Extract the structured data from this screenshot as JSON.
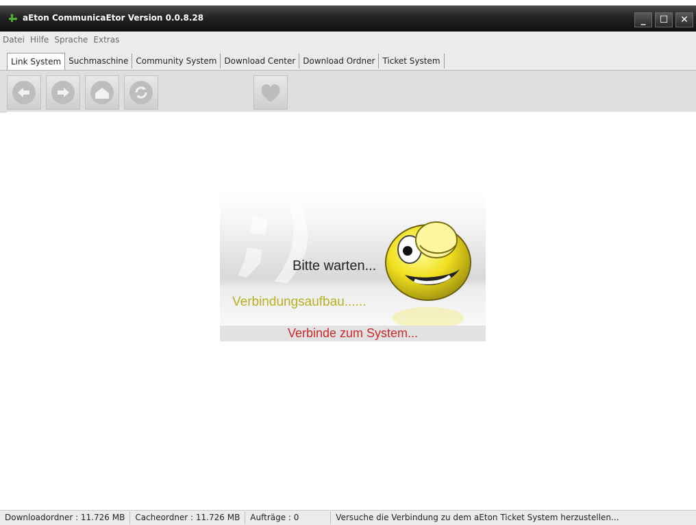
{
  "window": {
    "title": "aEton CommunicaEtor Version 0.0.8.28"
  },
  "menu": [
    "Datei",
    "Hilfe",
    "Sprache",
    "Extras"
  ],
  "tabs": [
    "Link System",
    "Suchmaschine",
    "Community System",
    "Download Center",
    "Download Ordner",
    "Ticket System"
  ],
  "active_tab": "Link System",
  "toolbar": {
    "icons": [
      "back-icon",
      "forward-icon",
      "home-icon",
      "refresh-icon",
      "favorite-heart-icon"
    ]
  },
  "splash": {
    "wait_text": "Bitte warten...",
    "connecting_text": "Verbindungsaufbau......",
    "connect_system_text": "Verbinde zum System..."
  },
  "status": {
    "download_folder": "Downloadordner :  11.726 MB",
    "cache_folder": "Cacheordner :  11.726 MB",
    "jobs": "Aufträge : 0",
    "message": "Versuche die Verbindung zu dem aEton Ticket System herzustellen..."
  },
  "colors": {
    "titlebar": "#1a1a1a",
    "splash_yellow_text": "#b8b020",
    "splash_red_text": "#cc2a2a"
  }
}
